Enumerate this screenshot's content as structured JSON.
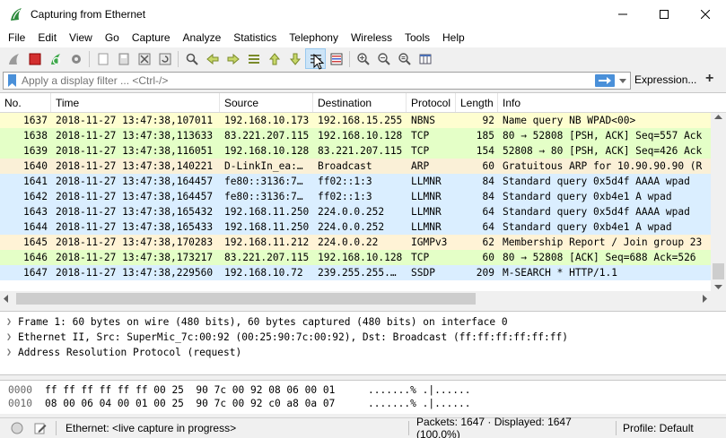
{
  "window": {
    "title": "Capturing from Ethernet"
  },
  "menu": [
    "File",
    "Edit",
    "View",
    "Go",
    "Capture",
    "Analyze",
    "Statistics",
    "Telephony",
    "Wireless",
    "Tools",
    "Help"
  ],
  "filter": {
    "placeholder": "Apply a display filter ... <Ctrl-/>",
    "expression_label": "Expression...",
    "add_label": "+"
  },
  "packet_list": {
    "columns": [
      "No.",
      "Time",
      "Source",
      "Destination",
      "Protocol",
      "Length",
      "Info"
    ],
    "rows": [
      {
        "no": "1637",
        "time": "2018-11-27 13:47:38,107011",
        "src": "192.168.10.173",
        "dst": "192.168.15.255",
        "proto": "NBNS",
        "len": "92",
        "info": "Name query NB WPAD<00>",
        "bg": "#fefed0"
      },
      {
        "no": "1638",
        "time": "2018-11-27 13:47:38,113633",
        "src": "83.221.207.115",
        "dst": "192.168.10.128",
        "proto": "TCP",
        "len": "185",
        "info": "80 → 52808 [PSH, ACK] Seq=557 Ack",
        "bg": "#e4ffc7"
      },
      {
        "no": "1639",
        "time": "2018-11-27 13:47:38,116051",
        "src": "192.168.10.128",
        "dst": "83.221.207.115",
        "proto": "TCP",
        "len": "154",
        "info": "52808 → 80 [PSH, ACK] Seq=426 Ack",
        "bg": "#e4ffc7"
      },
      {
        "no": "1640",
        "time": "2018-11-27 13:47:38,140221",
        "src": "D-LinkIn_ea:…",
        "dst": "Broadcast",
        "proto": "ARP",
        "len": "60",
        "info": "Gratuitous ARP for 10.90.90.90 (R",
        "bg": "#faf0d7"
      },
      {
        "no": "1641",
        "time": "2018-11-27 13:47:38,164457",
        "src": "fe80::3136:7…",
        "dst": "ff02::1:3",
        "proto": "LLMNR",
        "len": "84",
        "info": "Standard query 0x5d4f AAAA wpad",
        "bg": "#daeeff"
      },
      {
        "no": "1642",
        "time": "2018-11-27 13:47:38,164457",
        "src": "fe80::3136:7…",
        "dst": "ff02::1:3",
        "proto": "LLMNR",
        "len": "84",
        "info": "Standard query 0xb4e1 A wpad",
        "bg": "#daeeff"
      },
      {
        "no": "1643",
        "time": "2018-11-27 13:47:38,165432",
        "src": "192.168.11.250",
        "dst": "224.0.0.252",
        "proto": "LLMNR",
        "len": "64",
        "info": "Standard query 0x5d4f AAAA wpad",
        "bg": "#daeeff"
      },
      {
        "no": "1644",
        "time": "2018-11-27 13:47:38,165433",
        "src": "192.168.11.250",
        "dst": "224.0.0.252",
        "proto": "LLMNR",
        "len": "64",
        "info": "Standard query 0xb4e1 A wpad",
        "bg": "#daeeff"
      },
      {
        "no": "1645",
        "time": "2018-11-27 13:47:38,170283",
        "src": "192.168.11.212",
        "dst": "224.0.0.22",
        "proto": "IGMPv3",
        "len": "62",
        "info": "Membership Report / Join group 23",
        "bg": "#fff3d6"
      },
      {
        "no": "1646",
        "time": "2018-11-27 13:47:38,173217",
        "src": "83.221.207.115",
        "dst": "192.168.10.128",
        "proto": "TCP",
        "len": "60",
        "info": "80 → 52808 [ACK] Seq=688 Ack=526",
        "bg": "#e4ffc7"
      },
      {
        "no": "1647",
        "time": "2018-11-27 13:47:38,229560",
        "src": "192.168.10.72",
        "dst": "239.255.255.…",
        "proto": "SSDP",
        "len": "209",
        "info": "M-SEARCH * HTTP/1.1",
        "bg": "#daeeff"
      }
    ]
  },
  "details": [
    "Frame 1: 60 bytes on wire (480 bits), 60 bytes captured (480 bits) on interface 0",
    "Ethernet II, Src: SuperMic_7c:00:92 (00:25:90:7c:00:92), Dst: Broadcast (ff:ff:ff:ff:ff:ff)",
    "Address Resolution Protocol (request)"
  ],
  "bytes": [
    {
      "offset": "0000",
      "hex": "ff ff ff ff ff ff 00 25  90 7c 00 92 08 06 00 01",
      "ascii": ".......% .|......"
    },
    {
      "offset": "0010",
      "hex": "08 00 06 04 00 01 00 25  90 7c 00 92 c0 a8 0a 07",
      "ascii": ".......% .|......"
    }
  ],
  "status": {
    "interface": "Ethernet: <live capture in progress>",
    "packets": "Packets: 1647 · Displayed: 1647 (100.0%)",
    "profile": "Profile: Default"
  }
}
